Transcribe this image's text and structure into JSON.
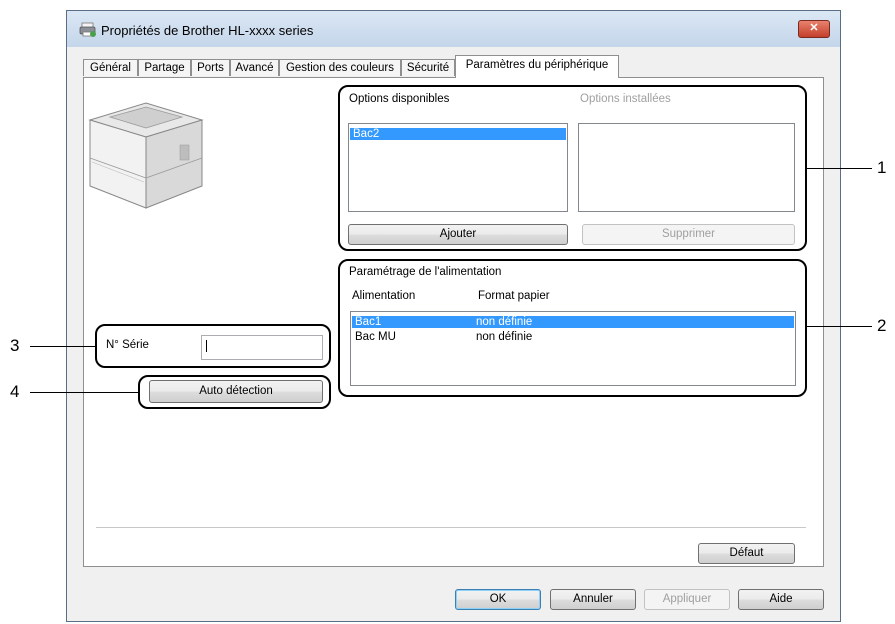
{
  "window": {
    "title": "Propriétés de Brother HL-xxxx  series",
    "close_glyph": "✕"
  },
  "tabs": [
    {
      "label": "Général",
      "active": false
    },
    {
      "label": "Partage",
      "active": false
    },
    {
      "label": "Ports",
      "active": false
    },
    {
      "label": "Avancé",
      "active": false
    },
    {
      "label": "Gestion des couleurs",
      "active": false
    },
    {
      "label": "Sécurité",
      "active": false
    },
    {
      "label": "Paramètres du périphérique",
      "active": true
    }
  ],
  "options": {
    "available_label": "Options disponibles",
    "installed_label": "Options installées",
    "available_items": [
      "Bac2"
    ],
    "installed_items": [],
    "add_button": "Ajouter",
    "remove_button": "Supprimer"
  },
  "power": {
    "group_label": "Paramétrage de l'alimentation",
    "col_source": "Alimentation",
    "col_format": "Format papier",
    "rows": [
      {
        "source": "Bac1",
        "format": "non définie",
        "selected": true
      },
      {
        "source": "Bac MU",
        "format": "non définie",
        "selected": false
      }
    ]
  },
  "serial": {
    "label": "N° Série",
    "value": ""
  },
  "auto_detect_button": "Auto détection",
  "default_button": "Défaut",
  "footer": {
    "ok": "OK",
    "cancel": "Annuler",
    "apply": "Appliquer",
    "help": "Aide"
  },
  "callouts": [
    "1",
    "2",
    "3",
    "4"
  ],
  "colors": {
    "selection": "#3399ff",
    "close_button": "#c3402b",
    "title_bar": "#c4d6ea"
  }
}
